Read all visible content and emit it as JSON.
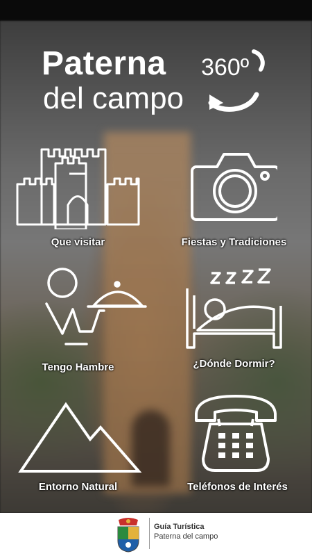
{
  "header": {
    "title_line1": "Paterna",
    "title_line2": "del campo",
    "badge": "360º"
  },
  "menu": [
    {
      "label": "Que visitar",
      "icon": "castle-icon"
    },
    {
      "label": "Fiestas y Tradiciones",
      "icon": "camera-icon"
    },
    {
      "label": "Tengo Hambre",
      "icon": "waiter-icon"
    },
    {
      "label": "¿Dónde Dormir?",
      "icon": "bed-icon"
    },
    {
      "label": "Entorno Natural",
      "icon": "mountain-icon"
    },
    {
      "label": "Teléfonos de Interés",
      "icon": "telephone-icon"
    }
  ],
  "footer": {
    "line1": "Guía Turística",
    "line2": "Paterna del campo"
  }
}
